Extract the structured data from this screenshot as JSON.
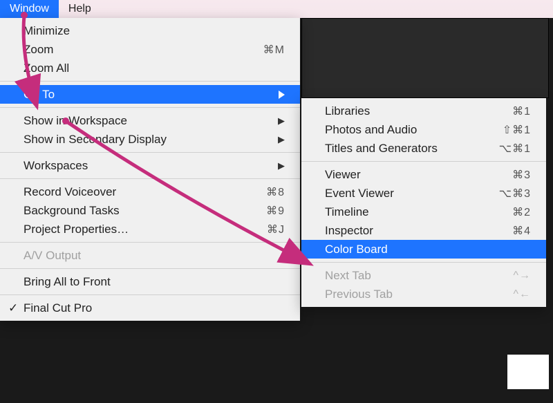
{
  "menubar": {
    "window": "Window",
    "help": "Help"
  },
  "primary_menu": {
    "minimize": "Minimize",
    "zoom": "Zoom",
    "zoom_shortcut": "⌘M",
    "zoom_all": "Zoom All",
    "go_to": "Go To",
    "show_workspace": "Show in Workspace",
    "show_secondary": "Show in Secondary Display",
    "workspaces": "Workspaces",
    "record_voiceover": "Record Voiceover",
    "record_shortcut": "⌘8",
    "background_tasks": "Background Tasks",
    "background_shortcut": "⌘9",
    "project_props": "Project Properties…",
    "project_shortcut": "⌘J",
    "av_output": "A/V Output",
    "bring_front": "Bring All to Front",
    "final_cut": "Final Cut Pro"
  },
  "secondary_menu": {
    "libraries": {
      "label": "Libraries",
      "shortcut": "⌘1"
    },
    "photos_audio": {
      "label": "Photos and Audio",
      "shortcut": "⇧⌘1"
    },
    "titles_gen": {
      "label": "Titles and Generators",
      "shortcut": "⌥⌘1"
    },
    "viewer": {
      "label": "Viewer",
      "shortcut": "⌘3"
    },
    "event_viewer": {
      "label": "Event Viewer",
      "shortcut": "⌥⌘3"
    },
    "timeline": {
      "label": "Timeline",
      "shortcut": "⌘2"
    },
    "inspector": {
      "label": "Inspector",
      "shortcut": "⌘4"
    },
    "color_board": {
      "label": "Color Board",
      "shortcut": ""
    },
    "next_tab": {
      "label": "Next Tab",
      "shortcut": "^→"
    },
    "prev_tab": {
      "label": "Previous Tab",
      "shortcut": "^←"
    }
  },
  "annotation": {
    "arrow_color": "#C52D7C"
  }
}
